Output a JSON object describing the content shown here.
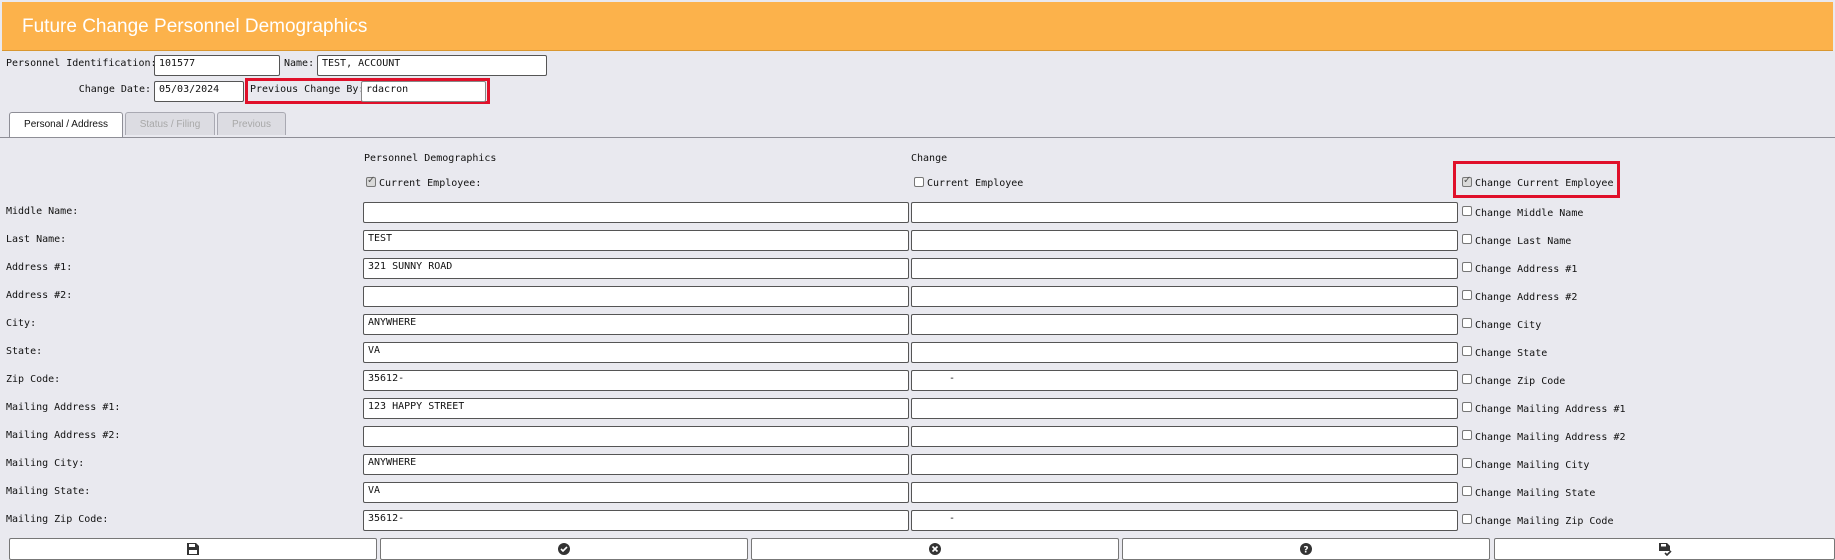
{
  "window": {
    "title": "Future Change Personnel Demographics"
  },
  "header": {
    "personnel_id_label": "Personnel Identification:",
    "personnel_id_value": "101577",
    "name_label": "Name:",
    "name_value": "TEST, ACCOUNT",
    "change_date_label": "Change Date:",
    "change_date_value": "05/03/2024",
    "prev_change_label": "Previous Change By:",
    "prev_change_value": "rdacron"
  },
  "tabs": [
    {
      "label": "Personal / Address",
      "active": true
    },
    {
      "label": "Status / Filing",
      "active": false
    },
    {
      "label": "Previous",
      "active": false
    }
  ],
  "columns": {
    "current_header": "Personnel Demographics",
    "change_header": "Change"
  },
  "current_employee": {
    "current_label": "Current Employee:",
    "current_checked": true,
    "change_label": "Current Employee",
    "change_checked": false,
    "toggle_label": "Change Current Employee",
    "toggle_checked": true
  },
  "rows": [
    {
      "label": "Middle Name:",
      "current": "",
      "change": "",
      "toggle_label": "Change Middle Name",
      "checked": false
    },
    {
      "label": "Last Name:",
      "current": "TEST",
      "change": "",
      "toggle_label": "Change Last Name",
      "checked": false
    },
    {
      "label": "Address #1:",
      "current": "321 SUNNY ROAD",
      "change": "",
      "toggle_label": "Change Address #1",
      "checked": false
    },
    {
      "label": "Address #2:",
      "current": "",
      "change": "",
      "toggle_label": "Change Address #2",
      "checked": false
    },
    {
      "label": "City:",
      "current": "ANYWHERE",
      "change": "",
      "toggle_label": "Change City",
      "checked": false
    },
    {
      "label": "State:",
      "current": "VA",
      "change": "",
      "toggle_label": "Change State",
      "checked": false
    },
    {
      "label": "Zip Code:",
      "current": "35612-",
      "change": "-",
      "toggle_label": "Change Zip Code",
      "checked": false
    },
    {
      "label": "Mailing Address #1:",
      "current": "123 HAPPY STREET",
      "change": "",
      "toggle_label": "Change Mailing Address #1",
      "checked": false
    },
    {
      "label": "Mailing Address #2:",
      "current": "",
      "change": "",
      "toggle_label": "Change Mailing Address #2",
      "checked": false
    },
    {
      "label": "Mailing City:",
      "current": "ANYWHERE",
      "change": "",
      "toggle_label": "Change Mailing City",
      "checked": false
    },
    {
      "label": "Mailing State:",
      "current": "VA",
      "change": "",
      "toggle_label": "Change Mailing State",
      "checked": false
    },
    {
      "label": "Mailing Zip Code:",
      "current": "35612-",
      "change": "-",
      "toggle_label": "Change Mailing Zip Code",
      "checked": false
    }
  ],
  "toolbar": {
    "buttons": [
      {
        "icon": "save-icon"
      },
      {
        "icon": "check-circle-icon"
      },
      {
        "icon": "close-circle-icon"
      },
      {
        "icon": "help-circle-icon"
      },
      {
        "icon": "save-check-icon"
      }
    ]
  },
  "colors": {
    "title_bar": "#fcb24b",
    "highlight": "#e0102a",
    "background": "#e9e9ef"
  }
}
